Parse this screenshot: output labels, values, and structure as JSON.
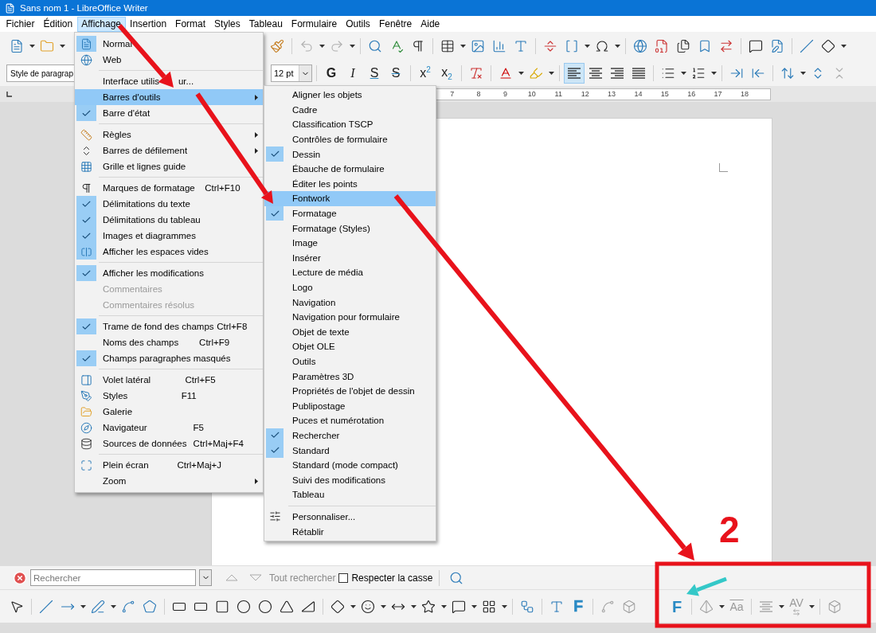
{
  "window": {
    "title": "Sans nom 1 - LibreOffice Writer"
  },
  "menubar": [
    {
      "label": "Fichier",
      "selected": false
    },
    {
      "label": "Édition",
      "selected": false
    },
    {
      "label": "Affichage",
      "selected": true
    },
    {
      "label": "Insertion",
      "selected": false
    },
    {
      "label": "Format",
      "selected": false
    },
    {
      "label": "Styles",
      "selected": false
    },
    {
      "label": "Tableau",
      "selected": false
    },
    {
      "label": "Formulaire",
      "selected": false
    },
    {
      "label": "Outils",
      "selected": false
    },
    {
      "label": "Fenêtre",
      "selected": false
    },
    {
      "label": "Aide",
      "selected": false
    }
  ],
  "formatting_toolbar": {
    "paragraph_style": "Style de paragrap",
    "font_size": "12 pt",
    "text_buttons": [
      {
        "label": "G",
        "kind": "bold"
      },
      {
        "label": "I",
        "kind": "italic"
      },
      {
        "label": "S",
        "kind": "underline"
      },
      {
        "label": "S",
        "kind": "strike"
      },
      {
        "label": "x$^{2}$",
        "kind": "script"
      },
      {
        "label": "x$_{2}$",
        "kind": "script"
      }
    ],
    "alignment": [
      {
        "selected": true
      },
      {
        "selected": false
      },
      {
        "selected": false
      },
      {
        "selected": false
      }
    ]
  },
  "ruler": {
    "numbers": [
      "7",
      "8",
      "9",
      "10",
      "11",
      "12",
      "13",
      "14",
      "15",
      "16",
      "17",
      "18"
    ]
  },
  "view_menu": {
    "sections": [
      [
        {
          "label": "Normal",
          "checked": true,
          "selected": false
        },
        {
          "label": "Web",
          "checked": false,
          "selected": false
        }
      ],
      [
        {
          "label": "Interface utilis",
          "label_tail": "ur...",
          "checked": false,
          "selected": false
        },
        {
          "label": "Barres d'outils",
          "checked": false,
          "selected": true,
          "submenu": true
        },
        {
          "label": "Barre d'état",
          "checked": true,
          "selected": false
        }
      ],
      [
        {
          "label": "Règles",
          "checked": false,
          "selected": false,
          "submenu": true
        },
        {
          "label": "Barres de défilement",
          "checked": false,
          "selected": false,
          "submenu": true
        },
        {
          "label": "Grille et lignes guide",
          "checked": false,
          "selected": false
        }
      ],
      [
        {
          "label": "Marques de formatage",
          "shortcut": "Ctrl+F10",
          "checked": false,
          "selected": false
        },
        {
          "label": "Délimitations du texte",
          "checked": true,
          "selected": false
        },
        {
          "label": "Délimitations du tableau",
          "checked": true,
          "selected": false
        },
        {
          "label": "Images et diagrammes",
          "checked": true,
          "selected": false
        },
        {
          "label": "Afficher les espaces vides",
          "checked": true,
          "selected": false
        }
      ],
      [
        {
          "label": "Afficher les modifications",
          "checked": true,
          "selected": false
        },
        {
          "label": "Commentaires",
          "checked": false,
          "selected": false,
          "disabled": true
        },
        {
          "label": "Commentaires résolus",
          "checked": false,
          "selected": false,
          "disabled": true
        }
      ],
      [
        {
          "label": "Trame de fond des champs",
          "shortcut": "Ctrl+F8",
          "checked": true,
          "selected": false
        },
        {
          "label": "Noms des champs",
          "shortcut": "Ctrl+F9",
          "checked": false,
          "selected": false
        },
        {
          "label": "Champs paragraphes masqués",
          "checked": true,
          "selected": false
        }
      ],
      [
        {
          "label": "Volet latéral",
          "shortcut": "Ctrl+F5",
          "checked": false,
          "selected": false
        },
        {
          "label": "Styles",
          "shortcut": "F11",
          "checked": false,
          "selected": false
        },
        {
          "label": "Galerie",
          "checked": false,
          "selected": false
        },
        {
          "label": "Navigateur",
          "shortcut": "F5",
          "checked": false,
          "selected": false
        },
        {
          "label": "Sources de données",
          "shortcut": "Ctrl+Maj+F4",
          "checked": false,
          "selected": false
        }
      ],
      [
        {
          "label": "Plein écran",
          "shortcut": "Ctrl+Maj+J",
          "checked": false,
          "selected": false
        },
        {
          "label": "Zoom",
          "checked": false,
          "selected": false,
          "submenu": true
        }
      ]
    ]
  },
  "toolbars_submenu": {
    "sections": [
      [
        {
          "label": "Aligner les objets",
          "checked": false,
          "selected": false
        },
        {
          "label": "Cadre",
          "checked": false,
          "selected": false
        },
        {
          "label": "Classification TSCP",
          "checked": false,
          "selected": false
        },
        {
          "label": "Contrôles de formulaire",
          "checked": false,
          "selected": false
        },
        {
          "label": "Dessin",
          "checked": true,
          "selected": false
        },
        {
          "label": "Ébauche de formulaire",
          "checked": false,
          "selected": false
        },
        {
          "label": "Éditer les points",
          "checked": false,
          "selected": false
        },
        {
          "label": "Fontwork",
          "checked": false,
          "selected": true
        },
        {
          "label": "Formatage",
          "checked": true,
          "selected": false
        },
        {
          "label": "Formatage (Styles)",
          "checked": false,
          "selected": false
        },
        {
          "label": "Image",
          "checked": false,
          "selected": false
        },
        {
          "label": "Insérer",
          "checked": false,
          "selected": false
        },
        {
          "label": "Lecture de média",
          "checked": false,
          "selected": false
        },
        {
          "label": "Logo",
          "checked": false,
          "selected": false
        },
        {
          "label": "Navigation",
          "checked": false,
          "selected": false
        },
        {
          "label": "Navigation pour formulaire",
          "checked": false,
          "selected": false
        },
        {
          "label": "Objet de texte",
          "checked": false,
          "selected": false
        },
        {
          "label": "Objet OLE",
          "checked": false,
          "selected": false
        },
        {
          "label": "Outils",
          "checked": false,
          "selected": false
        },
        {
          "label": "Paramètres 3D",
          "checked": false,
          "selected": false
        },
        {
          "label": "Propriétés de l'objet de dessin",
          "checked": false,
          "selected": false
        },
        {
          "label": "Publipostage",
          "checked": false,
          "selected": false
        },
        {
          "label": "Puces et numérotation",
          "checked": false,
          "selected": false
        },
        {
          "label": "Rechercher",
          "checked": true,
          "selected": false
        },
        {
          "label": "Standard",
          "checked": true,
          "selected": false
        },
        {
          "label": "Standard (mode compact)",
          "checked": false,
          "selected": false
        },
        {
          "label": "Suivi des modifications",
          "checked": false,
          "selected": false
        },
        {
          "label": "Tableau",
          "checked": false,
          "selected": false
        }
      ],
      [
        {
          "label": "Personnaliser...",
          "checked": false,
          "selected": false
        },
        {
          "label": "Rétablir",
          "checked": false,
          "selected": false
        }
      ]
    ]
  },
  "find_toolbar": {
    "placeholder": "Rechercher",
    "find_all": "Tout rechercher",
    "match_case": {
      "label": "Respecter la casse",
      "checked": false
    }
  },
  "drawing_toolbar": {
    "fontwork_glyph": "F"
  },
  "fontwork_toolbar": {
    "items": [
      {
        "kind": "fontwork",
        "label": "F",
        "disabled": false
      },
      {
        "kind": "shape",
        "disabled": true
      },
      {
        "kind": "same_height",
        "label": "Aa",
        "disabled": true
      },
      {
        "kind": "alignment",
        "disabled": true
      },
      {
        "kind": "spacing",
        "label": "AV",
        "disabled": true
      },
      {
        "kind": "extrusion",
        "disabled": true
      }
    ]
  },
  "annotation": {
    "step": "2"
  }
}
